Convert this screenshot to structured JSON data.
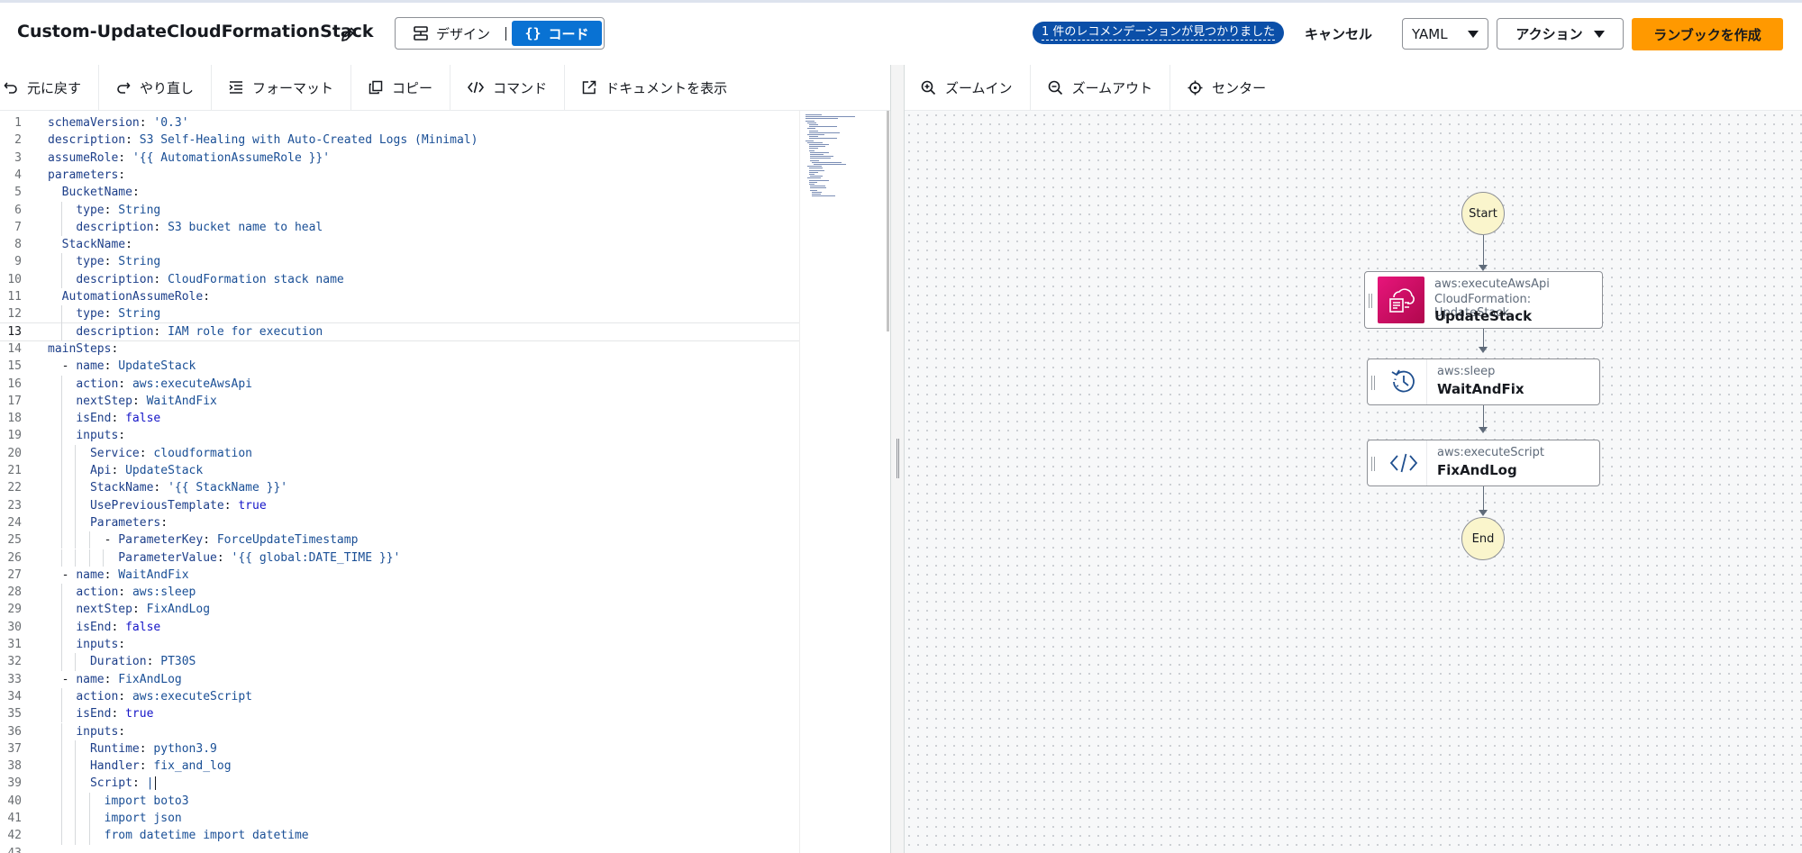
{
  "header": {
    "title": "Custom-UpdateCloudFormationStack",
    "mode_toggle": {
      "design_label": "デザイン",
      "code_label": "コード",
      "selected": "code"
    },
    "recommendation": "1 件のレコメンデーションが見つかりました",
    "cancel_label": "キャンセル",
    "format_select": "YAML",
    "actions_label": "アクション",
    "create_label": "ランブックを作成",
    "accent_color": "#ff9900",
    "primary_color": "#0972d3"
  },
  "editor_toolbar": {
    "undo": "元に戻す",
    "redo": "やり直し",
    "format": "フォーマット",
    "copy": "コピー",
    "command": "コマンド",
    "docs": "ドキュメントを表示"
  },
  "diagram_toolbar": {
    "zoom_in": "ズームイン",
    "zoom_out": "ズームアウト",
    "center": "センター"
  },
  "editor": {
    "active_line": 13,
    "lines": [
      [
        [
          "k",
          "schemaVersion"
        ],
        [
          "p",
          ": "
        ],
        [
          "v",
          "'0.3'"
        ]
      ],
      [
        [
          "k",
          "description"
        ],
        [
          "p",
          ": "
        ],
        [
          "v",
          "S3 Self-Healing with Auto-Created Logs (Minimal)"
        ]
      ],
      [
        [
          "k",
          "assumeRole"
        ],
        [
          "p",
          ": "
        ],
        [
          "v",
          "'{{ AutomationAssumeRole }}'"
        ]
      ],
      [
        [
          "k",
          "parameters"
        ],
        [
          "p",
          ":"
        ]
      ],
      [
        [
          "p",
          "  "
        ],
        [
          "k",
          "BucketName"
        ],
        [
          "p",
          ":"
        ]
      ],
      [
        [
          "p",
          "    "
        ],
        [
          "k",
          "type"
        ],
        [
          "p",
          ": "
        ],
        [
          "v",
          "String"
        ]
      ],
      [
        [
          "p",
          "    "
        ],
        [
          "k",
          "description"
        ],
        [
          "p",
          ": "
        ],
        [
          "v",
          "S3 bucket name to heal"
        ]
      ],
      [
        [
          "p",
          "  "
        ],
        [
          "k",
          "StackName"
        ],
        [
          "p",
          ":"
        ]
      ],
      [
        [
          "p",
          "    "
        ],
        [
          "k",
          "type"
        ],
        [
          "p",
          ": "
        ],
        [
          "v",
          "String"
        ]
      ],
      [
        [
          "p",
          "    "
        ],
        [
          "k",
          "description"
        ],
        [
          "p",
          ": "
        ],
        [
          "v",
          "CloudFormation stack name"
        ]
      ],
      [
        [
          "p",
          "  "
        ],
        [
          "k",
          "AutomationAssumeRole"
        ],
        [
          "p",
          ":"
        ]
      ],
      [
        [
          "p",
          "    "
        ],
        [
          "k",
          "type"
        ],
        [
          "p",
          ": "
        ],
        [
          "v",
          "String"
        ]
      ],
      [
        [
          "p",
          "    "
        ],
        [
          "k",
          "description"
        ],
        [
          "p",
          ": "
        ],
        [
          "v",
          "IAM role for execution"
        ]
      ],
      [
        [
          "k",
          "mainSteps"
        ],
        [
          "p",
          ":"
        ]
      ],
      [
        [
          "p",
          "  - "
        ],
        [
          "k",
          "name"
        ],
        [
          "p",
          ": "
        ],
        [
          "v",
          "UpdateStack"
        ]
      ],
      [
        [
          "p",
          "    "
        ],
        [
          "k",
          "action"
        ],
        [
          "p",
          ": "
        ],
        [
          "v",
          "aws:executeAwsApi"
        ]
      ],
      [
        [
          "p",
          "    "
        ],
        [
          "k",
          "nextStep"
        ],
        [
          "p",
          ": "
        ],
        [
          "v",
          "WaitAndFix"
        ]
      ],
      [
        [
          "p",
          "    "
        ],
        [
          "k",
          "isEnd"
        ],
        [
          "p",
          ": "
        ],
        [
          "b",
          "false"
        ]
      ],
      [
        [
          "p",
          "    "
        ],
        [
          "k",
          "inputs"
        ],
        [
          "p",
          ":"
        ]
      ],
      [
        [
          "p",
          "      "
        ],
        [
          "k",
          "Service"
        ],
        [
          "p",
          ": "
        ],
        [
          "v",
          "cloudformation"
        ]
      ],
      [
        [
          "p",
          "      "
        ],
        [
          "k",
          "Api"
        ],
        [
          "p",
          ": "
        ],
        [
          "v",
          "UpdateStack"
        ]
      ],
      [
        [
          "p",
          "      "
        ],
        [
          "k",
          "StackName"
        ],
        [
          "p",
          ": "
        ],
        [
          "v",
          "'{{ StackName }}'"
        ]
      ],
      [
        [
          "p",
          "      "
        ],
        [
          "k",
          "UsePreviousTemplate"
        ],
        [
          "p",
          ": "
        ],
        [
          "b",
          "true"
        ]
      ],
      [
        [
          "p",
          "      "
        ],
        [
          "k",
          "Parameters"
        ],
        [
          "p",
          ":"
        ]
      ],
      [
        [
          "p",
          "        - "
        ],
        [
          "k",
          "ParameterKey"
        ],
        [
          "p",
          ": "
        ],
        [
          "v",
          "ForceUpdateTimestamp"
        ]
      ],
      [
        [
          "p",
          "          "
        ],
        [
          "k",
          "ParameterValue"
        ],
        [
          "p",
          ": "
        ],
        [
          "v",
          "'{{ global:DATE_TIME }}'"
        ]
      ],
      [
        [
          "p",
          "  - "
        ],
        [
          "k",
          "name"
        ],
        [
          "p",
          ": "
        ],
        [
          "v",
          "WaitAndFix"
        ]
      ],
      [
        [
          "p",
          "    "
        ],
        [
          "k",
          "action"
        ],
        [
          "p",
          ": "
        ],
        [
          "v",
          "aws:sleep"
        ]
      ],
      [
        [
          "p",
          "    "
        ],
        [
          "k",
          "nextStep"
        ],
        [
          "p",
          ": "
        ],
        [
          "v",
          "FixAndLog"
        ]
      ],
      [
        [
          "p",
          "    "
        ],
        [
          "k",
          "isEnd"
        ],
        [
          "p",
          ": "
        ],
        [
          "b",
          "false"
        ]
      ],
      [
        [
          "p",
          "    "
        ],
        [
          "k",
          "inputs"
        ],
        [
          "p",
          ":"
        ]
      ],
      [
        [
          "p",
          "      "
        ],
        [
          "k",
          "Duration"
        ],
        [
          "p",
          ": "
        ],
        [
          "v",
          "PT30S"
        ]
      ],
      [
        [
          "p",
          "  - "
        ],
        [
          "k",
          "name"
        ],
        [
          "p",
          ": "
        ],
        [
          "v",
          "FixAndLog"
        ]
      ],
      [
        [
          "p",
          "    "
        ],
        [
          "k",
          "action"
        ],
        [
          "p",
          ": "
        ],
        [
          "v",
          "aws:executeScript"
        ]
      ],
      [
        [
          "p",
          "    "
        ],
        [
          "k",
          "isEnd"
        ],
        [
          "p",
          ": "
        ],
        [
          "b",
          "true"
        ]
      ],
      [
        [
          "p",
          "    "
        ],
        [
          "k",
          "inputs"
        ],
        [
          "p",
          ":"
        ]
      ],
      [
        [
          "p",
          "      "
        ],
        [
          "k",
          "Runtime"
        ],
        [
          "p",
          ": "
        ],
        [
          "v",
          "python3.9"
        ]
      ],
      [
        [
          "p",
          "      "
        ],
        [
          "k",
          "Handler"
        ],
        [
          "p",
          ": "
        ],
        [
          "v",
          "fix_and_log"
        ]
      ],
      [
        [
          "p",
          "      "
        ],
        [
          "k",
          "Script"
        ],
        [
          "p",
          ": "
        ],
        [
          "v",
          "|"
        ]
      ],
      [
        [
          "p",
          "        "
        ],
        [
          "v",
          "import boto3"
        ]
      ],
      [
        [
          "p",
          "        "
        ],
        [
          "v",
          "import json"
        ]
      ],
      [
        [
          "p",
          "        "
        ],
        [
          "v",
          "from datetime import datetime"
        ]
      ],
      [
        [
          "p",
          ""
        ]
      ]
    ]
  },
  "diagram": {
    "start_label": "Start",
    "end_label": "End",
    "steps": [
      {
        "type": "aws:executeAwsApi",
        "subtitle": "CloudFormation: UpdateStack",
        "name": "UpdateStack",
        "icon": "cloudformation-icon"
      },
      {
        "type": "aws:sleep",
        "subtitle": "",
        "name": "WaitAndFix",
        "icon": "sleep-clock-icon"
      },
      {
        "type": "aws:executeScript",
        "subtitle": "",
        "name": "FixAndLog",
        "icon": "code-brackets-icon"
      }
    ]
  }
}
